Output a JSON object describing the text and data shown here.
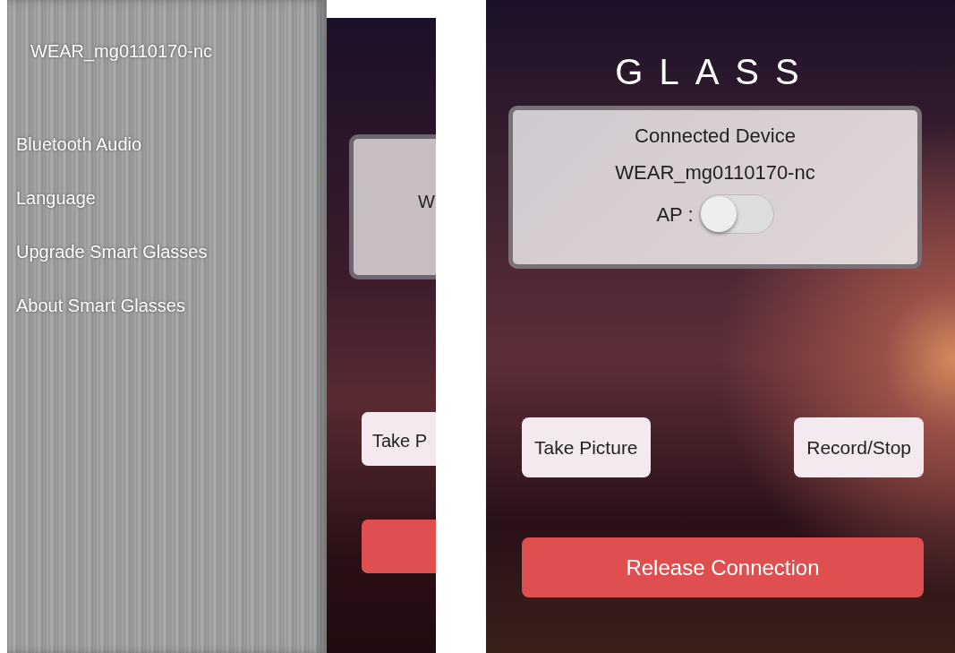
{
  "drawer": {
    "device_name": "WEAR_mg0110170-nc",
    "items": [
      {
        "label": "Bluetooth Audio"
      },
      {
        "label": "Language"
      },
      {
        "label": "Upgrade Smart Glasses"
      },
      {
        "label": "About Smart Glasses"
      }
    ]
  },
  "background_screen": {
    "card_text": "W",
    "button_text": "Take P"
  },
  "main": {
    "logo": "GLASS",
    "card": {
      "title": "Connected Device",
      "device": "WEAR_mg0110170-nc",
      "ap_label": "AP :",
      "ap_on": false
    },
    "buttons": [
      {
        "label": "Take Picture",
        "kind": "light"
      },
      {
        "label": "Record/Stop",
        "kind": "light"
      },
      {
        "label": "Release Connection",
        "kind": "danger"
      }
    ]
  }
}
